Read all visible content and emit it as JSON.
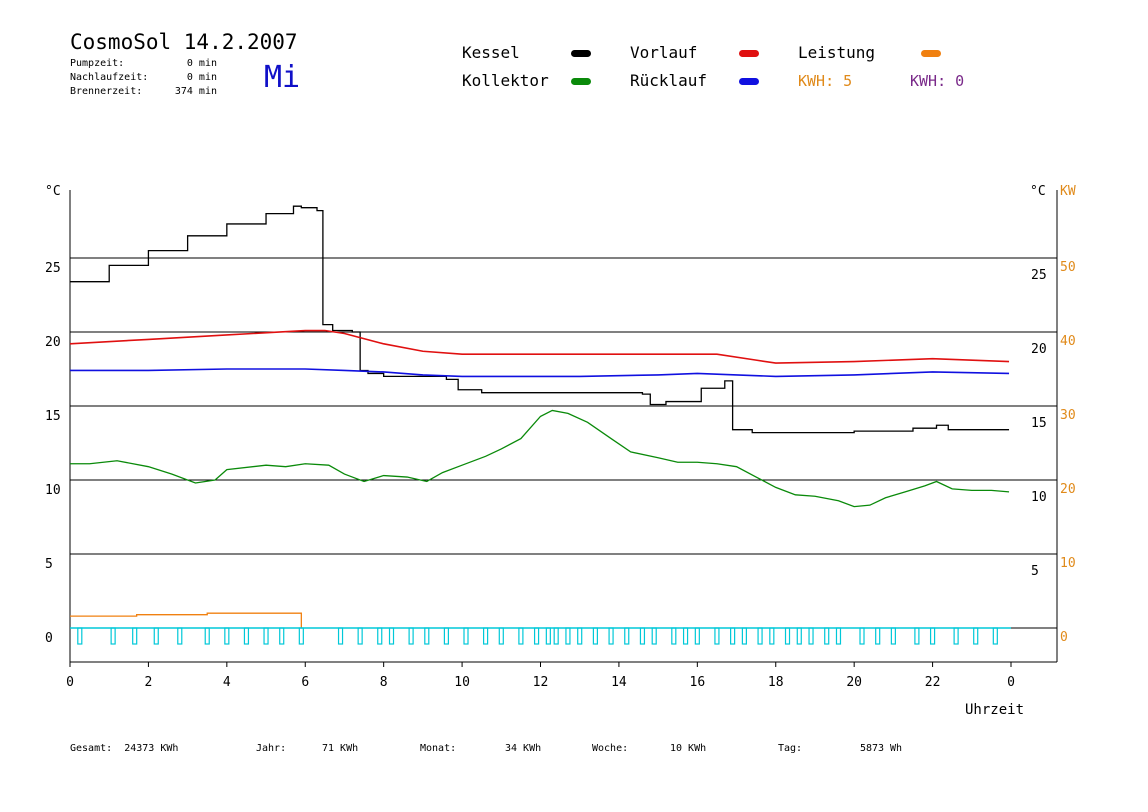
{
  "header": {
    "title": "CosmoSol 14.2.2007",
    "day": "Mi",
    "stats": [
      {
        "label": "Pumpzeit:",
        "value": "0 min"
      },
      {
        "label": "Nachlaufzeit:",
        "value": "0 min"
      },
      {
        "label": "Brennerzeit:",
        "value": "374 min"
      }
    ]
  },
  "legend": {
    "items": [
      {
        "label": "Kessel",
        "color": "#000000"
      },
      {
        "label": "Kollektor",
        "color": "#0a8a0a"
      },
      {
        "label": "Vorlauf",
        "color": "#e01010"
      },
      {
        "label": "Rücklauf",
        "color": "#1010e0"
      },
      {
        "label": "Leistung",
        "color": "#f08010"
      }
    ],
    "kwh_1": "KWH: 5",
    "kwh_1_color": "#e08a1a",
    "kwh_2": "KWH: 0",
    "kwh_2_color": "#7a2a8a"
  },
  "footer": [
    {
      "label": "Gesamt:",
      "value": "24373 KWh"
    },
    {
      "label": "Jahr:",
      "value": "71 KWh"
    },
    {
      "label": "Monat:",
      "value": "34 KWh"
    },
    {
      "label": "Woche:",
      "value": "10 KWh"
    },
    {
      "label": "Tag:",
      "value": "5873 Wh"
    }
  ],
  "chart_data": {
    "type": "line",
    "xlabel": "Uhrzeit",
    "ylabel_left": "°C",
    "ylabel_right": "°C",
    "ylabel_right2": "KW",
    "x_ticks": [
      "0",
      "2",
      "4",
      "6",
      "8",
      "10",
      "12",
      "14",
      "16",
      "18",
      "20",
      "22",
      "0"
    ],
    "xlim": [
      0,
      24
    ],
    "ylim_left": [
      -1.5,
      30
    ],
    "left_ticks": [
      "0",
      "5",
      "10",
      "15",
      "20",
      "25"
    ],
    "right_ticks_temp": [
      "5",
      "10",
      "15",
      "20",
      "25"
    ],
    "right_ticks_kw": [
      "0",
      "10",
      "20",
      "30",
      "40",
      "50"
    ],
    "grid": "horizontal",
    "series": [
      {
        "name": "Kessel",
        "color": "#000000",
        "points": [
          [
            0,
            23.4
          ],
          [
            1,
            24.5
          ],
          [
            2,
            25.5
          ],
          [
            3,
            26.5
          ],
          [
            4,
            27.3
          ],
          [
            5,
            28
          ],
          [
            5.7,
            28.5
          ],
          [
            5.9,
            28.4
          ],
          [
            6.3,
            28.2
          ],
          [
            6.45,
            20.5
          ],
          [
            6.7,
            20.1
          ],
          [
            7.2,
            20
          ],
          [
            7.4,
            17.4
          ],
          [
            7.6,
            17.2
          ],
          [
            8,
            17.0
          ],
          [
            9.6,
            16.8
          ],
          [
            9.9,
            16.1
          ],
          [
            10.5,
            15.9
          ],
          [
            14.6,
            15.8
          ],
          [
            14.8,
            15.1
          ],
          [
            15.2,
            15.3
          ],
          [
            16.1,
            16.2
          ],
          [
            16.7,
            16.7
          ],
          [
            16.9,
            13.4
          ],
          [
            17.4,
            13.2
          ],
          [
            18.5,
            13.2
          ],
          [
            20,
            13.3
          ],
          [
            21.5,
            13.5
          ],
          [
            22.1,
            13.7
          ],
          [
            22.4,
            13.4
          ],
          [
            23.95,
            13.4
          ]
        ]
      },
      {
        "name": "Vorlauf",
        "color": "#e01010",
        "points": [
          [
            0,
            19.2
          ],
          [
            2,
            19.5
          ],
          [
            4,
            19.8
          ],
          [
            6,
            20.1
          ],
          [
            6.5,
            20.1
          ],
          [
            7,
            19.9
          ],
          [
            8,
            19.2
          ],
          [
            9,
            18.7
          ],
          [
            10,
            18.5
          ],
          [
            14,
            18.5
          ],
          [
            16,
            18.5
          ],
          [
            16.5,
            18.5
          ],
          [
            17.5,
            18.1
          ],
          [
            18,
            17.9
          ],
          [
            20,
            18.0
          ],
          [
            22,
            18.2
          ],
          [
            23.95,
            18.0
          ]
        ]
      },
      {
        "name": "Rücklauf",
        "color": "#1010e0",
        "points": [
          [
            0,
            17.4
          ],
          [
            2,
            17.4
          ],
          [
            4,
            17.5
          ],
          [
            6,
            17.5
          ],
          [
            7,
            17.4
          ],
          [
            8,
            17.3
          ],
          [
            9,
            17.1
          ],
          [
            10,
            17.0
          ],
          [
            13,
            17.0
          ],
          [
            15,
            17.1
          ],
          [
            16,
            17.2
          ],
          [
            17,
            17.1
          ],
          [
            18,
            17.0
          ],
          [
            20,
            17.1
          ],
          [
            22,
            17.3
          ],
          [
            23.95,
            17.2
          ]
        ]
      },
      {
        "name": "Kollektor",
        "color": "#0a8a0a",
        "points": [
          [
            0,
            11.1
          ],
          [
            0.5,
            11.1
          ],
          [
            1.2,
            11.3
          ],
          [
            2,
            10.9
          ],
          [
            2.6,
            10.4
          ],
          [
            3.2,
            9.8
          ],
          [
            3.7,
            10.0
          ],
          [
            4,
            10.7
          ],
          [
            5,
            11.0
          ],
          [
            5.5,
            10.9
          ],
          [
            6,
            11.1
          ],
          [
            6.6,
            11.0
          ],
          [
            7,
            10.4
          ],
          [
            7.5,
            9.9
          ],
          [
            8,
            10.3
          ],
          [
            8.6,
            10.2
          ],
          [
            9.1,
            9.9
          ],
          [
            9.5,
            10.5
          ],
          [
            10,
            11.0
          ],
          [
            10.6,
            11.6
          ],
          [
            11,
            12.1
          ],
          [
            11.5,
            12.8
          ],
          [
            12,
            14.3
          ],
          [
            12.3,
            14.7
          ],
          [
            12.7,
            14.5
          ],
          [
            13.2,
            13.9
          ],
          [
            13.8,
            12.8
          ],
          [
            14.3,
            11.9
          ],
          [
            15,
            11.5
          ],
          [
            15.5,
            11.2
          ],
          [
            16,
            11.2
          ],
          [
            16.5,
            11.1
          ],
          [
            17,
            10.9
          ],
          [
            17.5,
            10.2
          ],
          [
            18,
            9.5
          ],
          [
            18.5,
            9.0
          ],
          [
            19,
            8.9
          ],
          [
            19.6,
            8.6
          ],
          [
            20,
            8.2
          ],
          [
            20.4,
            8.3
          ],
          [
            20.8,
            8.8
          ],
          [
            21.3,
            9.2
          ],
          [
            21.8,
            9.6
          ],
          [
            22.1,
            9.9
          ],
          [
            22.5,
            9.4
          ],
          [
            23,
            9.3
          ],
          [
            23.5,
            9.3
          ],
          [
            23.95,
            9.2
          ]
        ]
      },
      {
        "name": "Leistung",
        "color": "#f08010",
        "points": [
          [
            0,
            0.8
          ],
          [
            1.7,
            0.8
          ],
          [
            1.7,
            0.9
          ],
          [
            3.5,
            0.9
          ],
          [
            3.5,
            1.0
          ],
          [
            5.9,
            1.0
          ],
          [
            5.9,
            0
          ]
        ]
      }
    ],
    "pump_pulses_x": [
      0.25,
      1.1,
      1.65,
      2.2,
      2.8,
      3.5,
      4,
      4.5,
      5,
      5.4,
      5.9,
      6.9,
      7.4,
      7.9,
      8.2,
      8.7,
      9.1,
      9.6,
      10.1,
      10.6,
      11.0,
      11.5,
      11.9,
      12.2,
      12.4,
      12.7,
      13.0,
      13.4,
      13.8,
      14.2,
      14.6,
      14.9,
      15.4,
      15.7,
      16.0,
      16.5,
      16.9,
      17.2,
      17.6,
      17.9,
      18.3,
      18.6,
      18.9,
      19.3,
      19.6,
      20.2,
      20.6,
      21.0,
      21.6,
      22.0,
      22.6,
      23.1,
      23.6
    ]
  }
}
